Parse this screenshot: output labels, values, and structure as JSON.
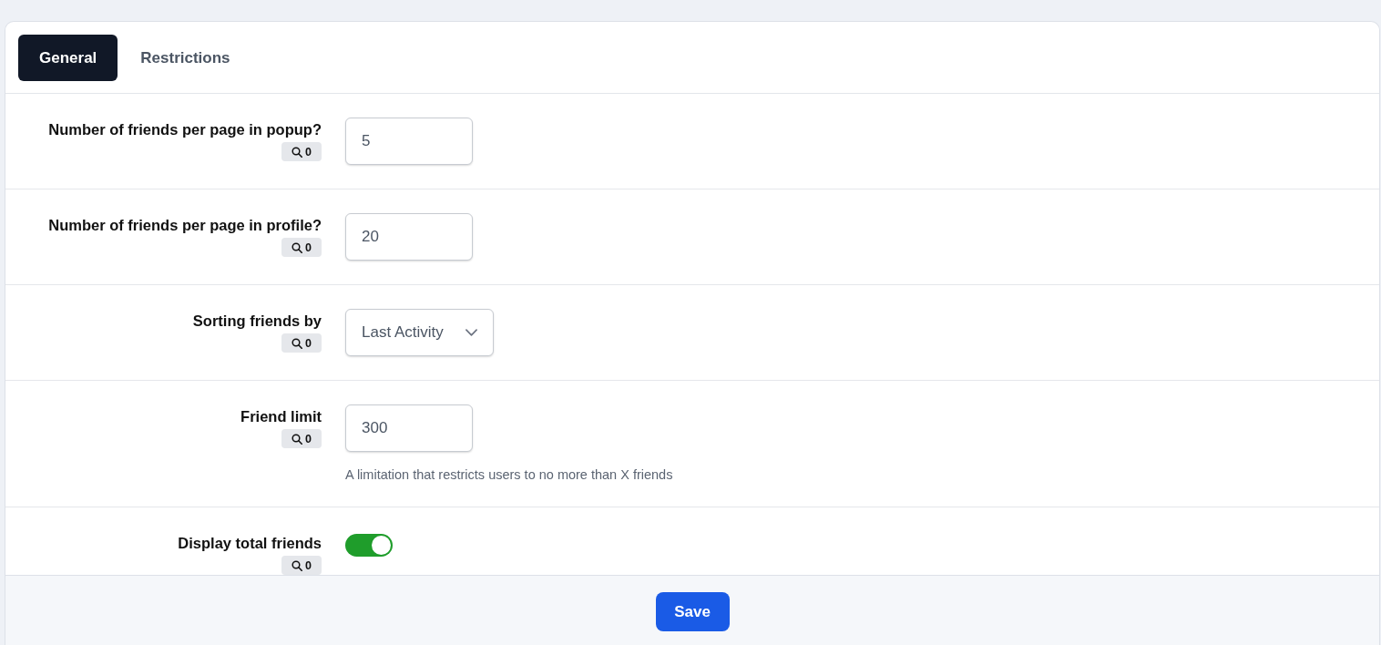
{
  "tabs": [
    {
      "label": "General",
      "selected": true
    },
    {
      "label": "Restrictions",
      "selected": false
    }
  ],
  "settings": [
    {
      "kind": "number",
      "label": "Number of friends per page in popup?",
      "badge_count": "0",
      "value": "5"
    },
    {
      "kind": "number",
      "label": "Number of friends per page in profile?",
      "badge_count": "0",
      "value": "20"
    },
    {
      "kind": "select",
      "label": "Sorting friends by",
      "badge_count": "0",
      "value": "Last Activity"
    },
    {
      "kind": "number",
      "label": "Friend limit",
      "badge_count": "0",
      "value": "300",
      "help": "A limitation that restricts users to no more than X friends"
    },
    {
      "kind": "toggle",
      "label": "Display total friends",
      "badge_count": "0",
      "on": true
    }
  ],
  "footer": {
    "save_button": "Save"
  }
}
